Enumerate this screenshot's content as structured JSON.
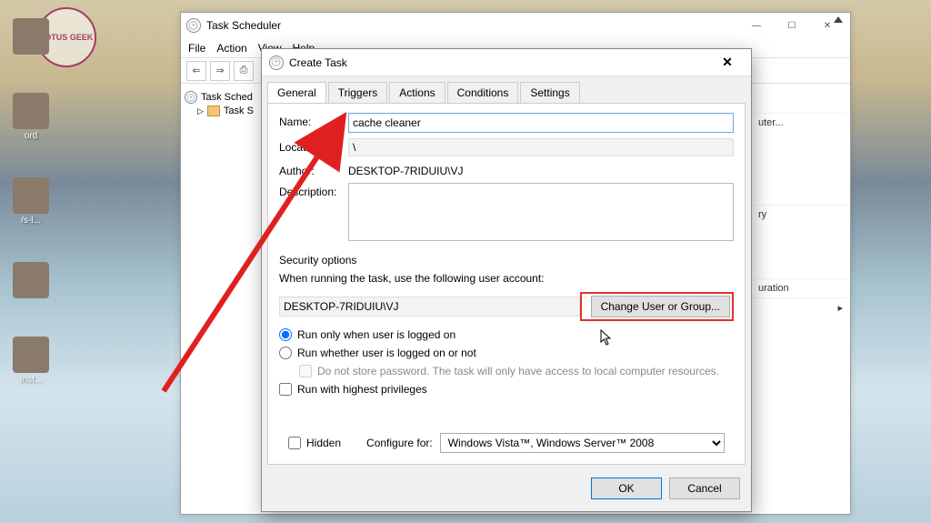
{
  "desktop": {
    "icons": [
      {
        "label": ""
      },
      {
        "label": "ord"
      },
      {
        "label": "/s-l..."
      },
      {
        "label": ""
      },
      {
        "label": "Inst..."
      }
    ],
    "logo_text": "LOTUS GEEK"
  },
  "task_scheduler": {
    "title": "Task Scheduler",
    "menu": [
      "File",
      "Action",
      "View",
      "Help"
    ],
    "toolbar": [
      "⇐",
      "⇒",
      "⎙"
    ],
    "tree": {
      "root": "Task Sched",
      "child": "Task S"
    },
    "actions_pane": {
      "header": "",
      "items": [
        "uter...",
        "ry",
        "uration",
        "▸"
      ]
    }
  },
  "create_task": {
    "title": "Create Task",
    "close": "✕",
    "tabs": [
      "General",
      "Triggers",
      "Actions",
      "Conditions",
      "Settings"
    ],
    "general": {
      "name_label": "Name:",
      "name_value": "cache cleaner",
      "location_label": "Location:",
      "location_value": "\\",
      "author_label": "Author:",
      "author_value": "DESKTOP-7RIDUIU\\VJ",
      "description_label": "Description:",
      "description_value": "",
      "security_header": "Security options",
      "security_text": "When running the task, use the following user account:",
      "user_account": "DESKTOP-7RIDUIU\\VJ",
      "change_user_btn": "Change User or Group...",
      "radio_logged_on": "Run only when user is logged on",
      "radio_logged_on_checked": true,
      "radio_any": "Run whether user is logged on or not",
      "no_store_pw": "Do not store password.  The task will only have access to local computer resources.",
      "chk_highest": "Run with highest privileges",
      "chk_hidden": "Hidden",
      "configure_label": "Configure for:",
      "configure_value": "Windows Vista™, Windows Server™ 2008"
    },
    "buttons": {
      "ok": "OK",
      "cancel": "Cancel"
    }
  }
}
